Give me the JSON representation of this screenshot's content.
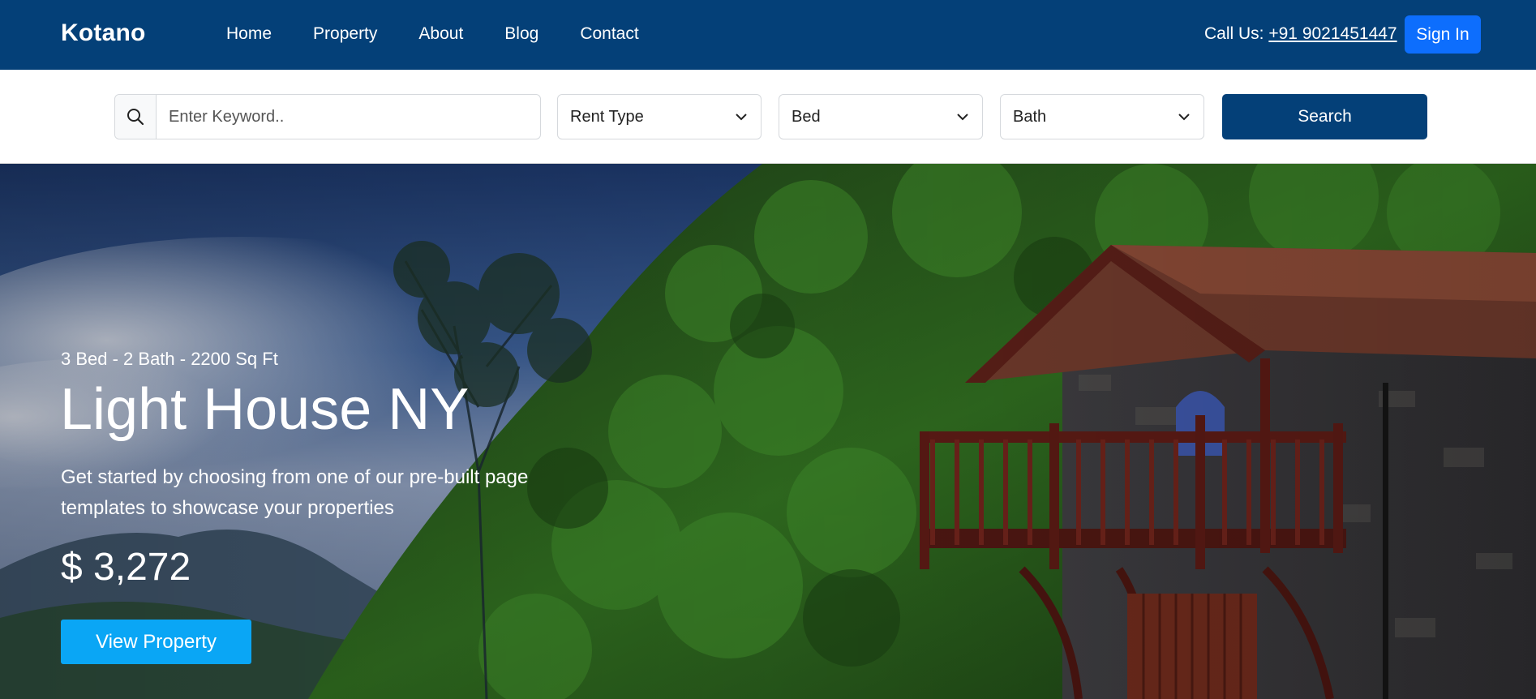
{
  "navbar": {
    "brand": "Kotano",
    "links": [
      "Home",
      "Property",
      "About",
      "Blog",
      "Contact"
    ],
    "call_label": "Call Us: ",
    "phone": "+91 9021451447",
    "signin_label": "Sign In"
  },
  "search": {
    "keyword_placeholder": "Enter Keyword..",
    "rent_type": "Rent Type",
    "bed": "Bed",
    "bath": "Bath",
    "button_label": "Search"
  },
  "hero": {
    "meta": "3 Bed - 2 Bath - 2200 Sq Ft",
    "title": "Light House NY",
    "description": "Get started by choosing from one of our pre-built page templates to showcase your properties",
    "price": "$ 3,272",
    "button_label": "View Property"
  },
  "colors": {
    "navbar_bg": "#044078",
    "signin_bg": "#0d6efd",
    "search_btn_bg": "#044078",
    "view_btn_bg": "#0aa6f5"
  },
  "icons": {
    "search": "search-icon",
    "dropdown": "chevron-down-icon"
  }
}
